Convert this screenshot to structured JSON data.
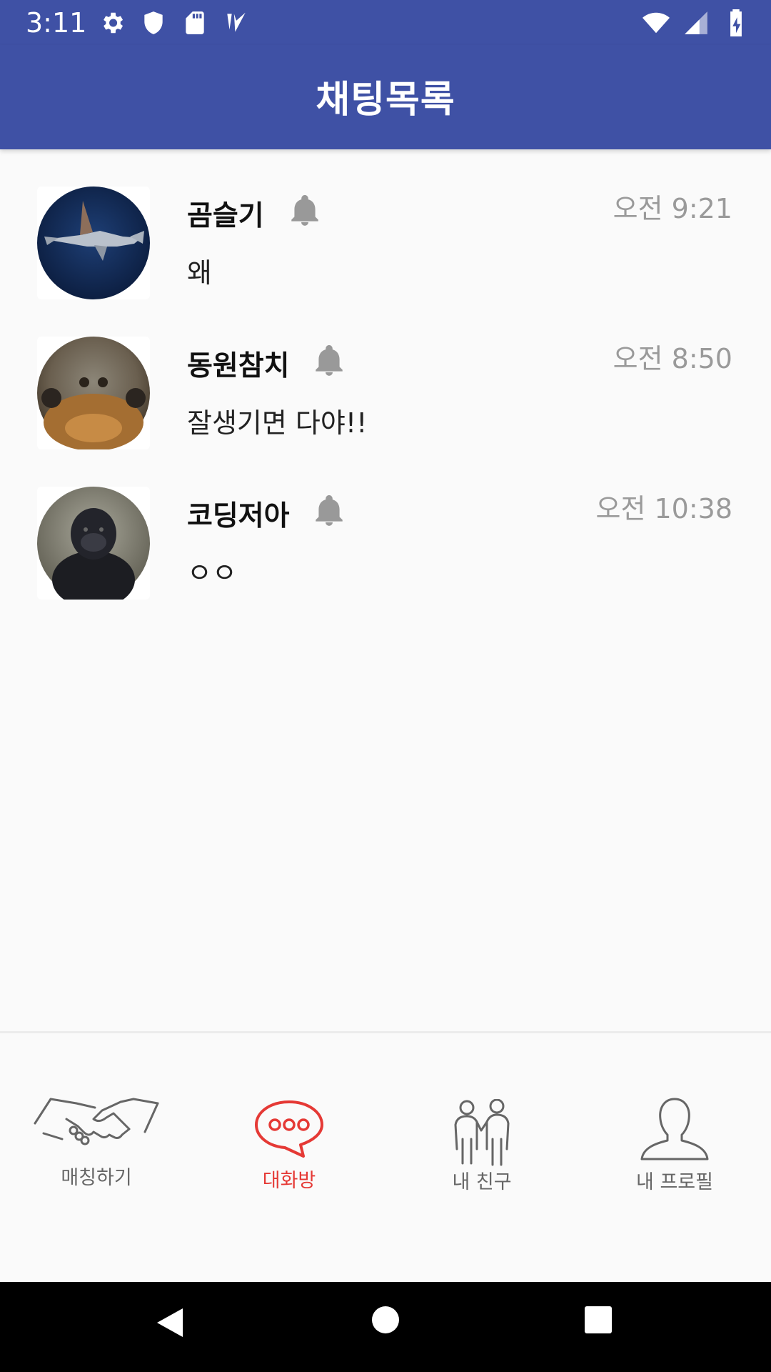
{
  "status_bar": {
    "time": "3:11",
    "left_icons": [
      "gear-icon",
      "shield-icon",
      "sd-card-icon",
      "task-check-icon"
    ],
    "right_icons": [
      "wifi-icon",
      "signal-icon",
      "battery-charging-icon"
    ]
  },
  "app_bar": {
    "title": "채팅목록",
    "color": "#3f51a5"
  },
  "chats": [
    {
      "name": "곰슬기",
      "message": "왜",
      "time": "오전 9:21",
      "avatar": "hammerhead-shark-photo"
    },
    {
      "name": "동원참치",
      "message": "잘생기면 다야!!",
      "time": "오전 8:50",
      "avatar": "sea-turtle-photo"
    },
    {
      "name": "코딩저아",
      "message": "ㅇㅇ",
      "time": "오전 10:38",
      "avatar": "gorilla-photo"
    }
  ],
  "bottom_nav": {
    "items": [
      {
        "label": "매칭하기",
        "icon": "handshake-icon",
        "active": false
      },
      {
        "label": "대화방",
        "icon": "chat-bubble-icon",
        "active": true
      },
      {
        "label": "내 친구",
        "icon": "friends-icon",
        "active": false
      },
      {
        "label": "내 프로필",
        "icon": "profile-icon",
        "active": false
      }
    ],
    "active_color": "#e53935",
    "inactive_color": "#666666"
  },
  "system_nav": {
    "buttons": [
      "back-icon",
      "home-icon",
      "recents-icon"
    ]
  }
}
